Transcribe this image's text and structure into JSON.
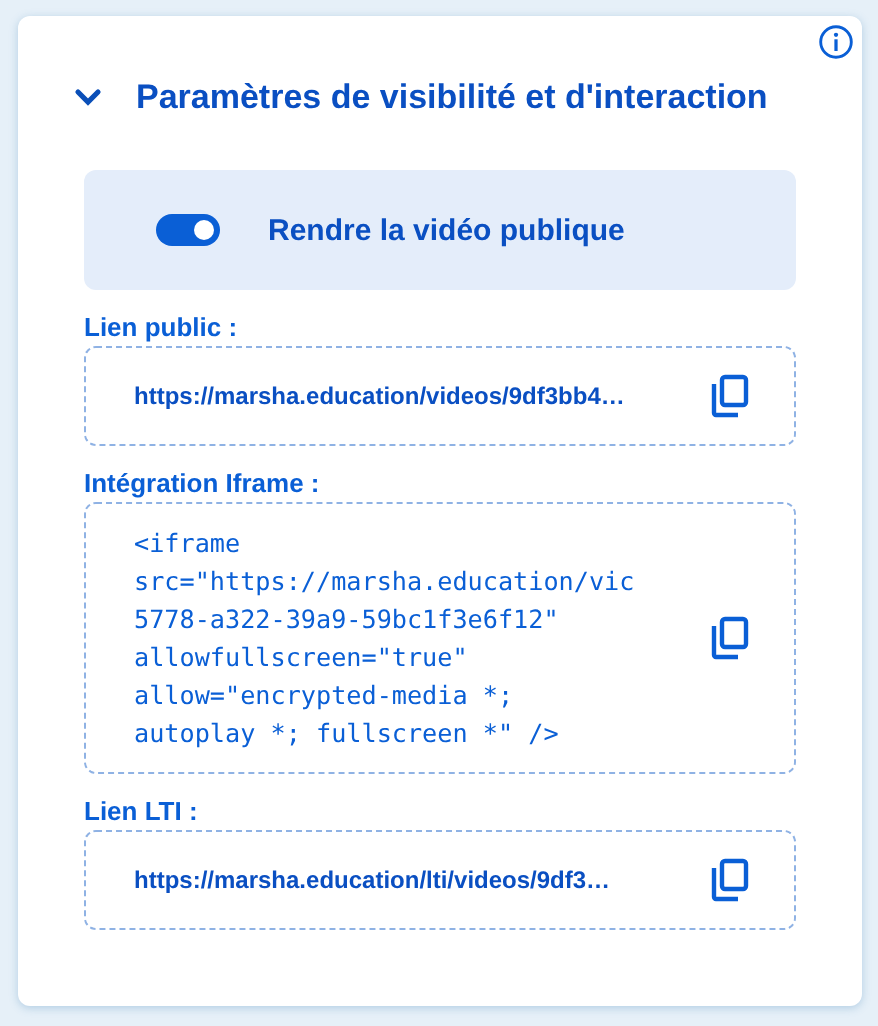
{
  "panel": {
    "title": "Paramètres de visibilité et d'interaction",
    "expanded": true
  },
  "toggle": {
    "label": "Rendre la vidéo publique",
    "on": true
  },
  "fields": [
    {
      "kind": "link",
      "label": "Lien public :",
      "value": "https://marsha.education/videos/9df3bb4…"
    },
    {
      "kind": "code",
      "label": "Intégration Iframe :",
      "value": "<iframe\nsrc=\"https://marsha.education/vic\n5778-a322-39a9-59bc1f3e6f12\"\nallowfullscreen=\"true\"\nallow=\"encrypted-media *;\nautoplay *; fullscreen *\" />"
    },
    {
      "kind": "link",
      "label": "Lien LTI :",
      "value": "https://marsha.education/lti/videos/9df3…"
    }
  ]
}
